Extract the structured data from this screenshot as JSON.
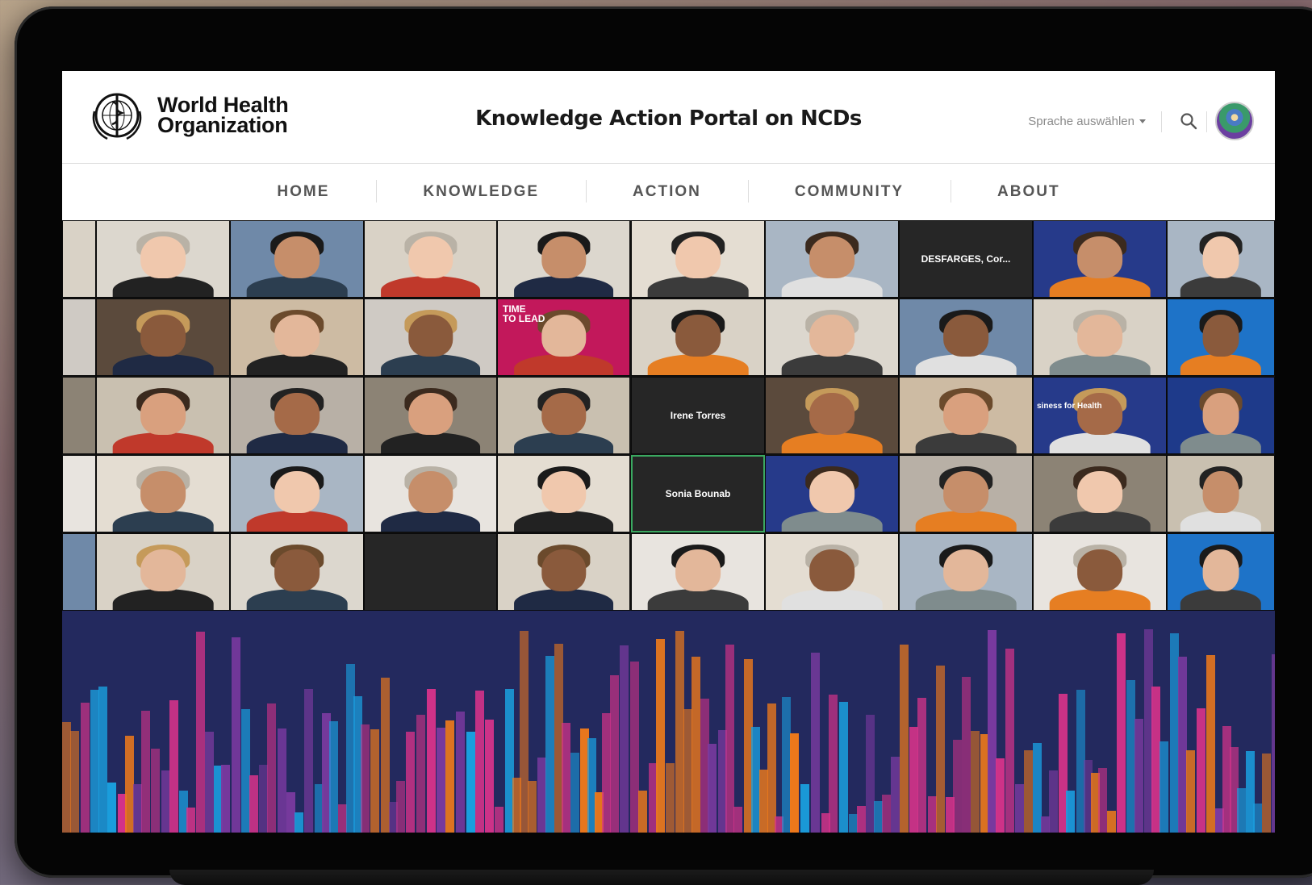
{
  "header": {
    "logo_line1": "World Health",
    "logo_line2": "Organization",
    "title": "Knowledge Action Portal on NCDs",
    "language_selector": "Sprache auswählen"
  },
  "nav": {
    "items": [
      {
        "label": "HOME"
      },
      {
        "label": "KNOWLEDGE"
      },
      {
        "label": "ACTION"
      },
      {
        "label": "COMMUNITY"
      },
      {
        "label": "ABOUT"
      }
    ]
  },
  "meeting": {
    "tile_labels": {
      "desfarges": "DESFARGES, Cor...",
      "irene": "Irene Torres",
      "sonia": "Sonia Bounab",
      "time_to_lead_1": "TIME",
      "time_to_lead_2": "TO LEAD",
      "business_for_health": "siness for Health"
    }
  },
  "colors": {
    "bar_blue": "#1aa0e0",
    "bar_orange": "#f07a1a",
    "bar_pink": "#d6338a",
    "bar_purple": "#7b3aa0",
    "banner_bg": "#23295e"
  }
}
